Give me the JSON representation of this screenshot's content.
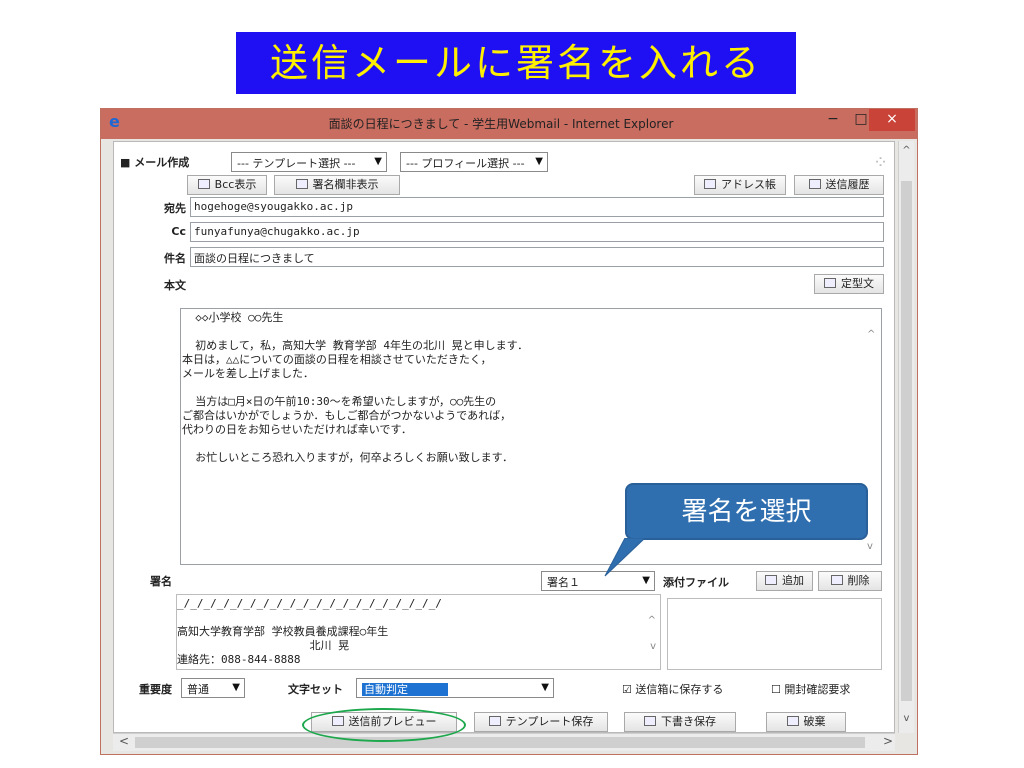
{
  "slide": {
    "title": "送信メールに署名を入れる"
  },
  "window": {
    "title": "面談の日程につきまして - 学生用Webmail - Internet Explorer",
    "min": "−",
    "max": "□",
    "close": "×"
  },
  "compose": {
    "section_label": "■ メール作成",
    "template_select": "--- テンプレート選択 ---",
    "profile_select": "--- プロフィール選択 ---",
    "bcc_button": "Bcc表示",
    "signature_toggle_button": "署名欄非表示",
    "address_book_button": "アドレス帳",
    "sent_history_button": "送信履歴",
    "to_label": "宛先",
    "to_value": "hogehoge@syougakko.ac.jp",
    "cc_label": "Cc",
    "cc_value": "funyafunya@chugakko.ac.jp",
    "subject_label": "件名",
    "subject_value": "面談の日程につきまして",
    "body_label": "本文",
    "boilerplate_button": "定型文",
    "body_text": "  ◇◇小学校 ○○先生\n\n  初めまして，私，高知大学 教育学部 4年生の北川 晃と申します．\n本日は，△△についての面談の日程を相談させていただきたく，\nメールを差し上げました．\n\n  当方は□月×日の午前10:30〜を希望いたしますが，○○先生の\nご都合はいかがでしょうか．もしご都合がつかないようであれば，\n代わりの日をお知らせいただければ幸いです．\n\n  お忙しいところ恐れ入りますが，何卒よろしくお願い致します．",
    "signature_label": "署名",
    "signature_select": "署名１",
    "attach_label": "添付ファイル",
    "attach_add": "追加",
    "attach_delete": "削除",
    "signature_text": "_/_/_/_/_/_/_/_/_/_/_/_/_/_/_/_/_/_/_/_/\n\n高知大学教育学部 学校教員養成課程○年生\n                    北川 晃\n連絡先：088-844-8888",
    "importance_label": "重要度",
    "importance_value": "普通",
    "charset_label": "文字セット",
    "charset_value": "自動判定",
    "save_sent_label": "送信箱に保存する",
    "save_sent_checked": true,
    "read_receipt_label": "開封確認要求",
    "read_receipt_checked": false,
    "preview_button": "送信前プレビュー",
    "save_template_button": "テンプレート保存",
    "save_draft_button": "下書き保存",
    "discard_button": "破棄"
  },
  "callout": {
    "text": "署名を選択"
  },
  "colors": {
    "title_bg": "#1f10f4",
    "title_fg": "#ffef00",
    "titlebar": "#c96d60",
    "callout": "#2f6fb0",
    "ellipse": "#1ea84d",
    "charset_highlight": "#1e73d2"
  },
  "icons": [
    "ie-logo-icon",
    "bcc-icon",
    "signature-icon",
    "address-book-icon",
    "history-icon",
    "boilerplate-icon",
    "add-attach-icon",
    "delete-attach-icon",
    "preview-icon",
    "template-save-icon",
    "draft-icon",
    "discard-icon",
    "spinner-icon"
  ]
}
